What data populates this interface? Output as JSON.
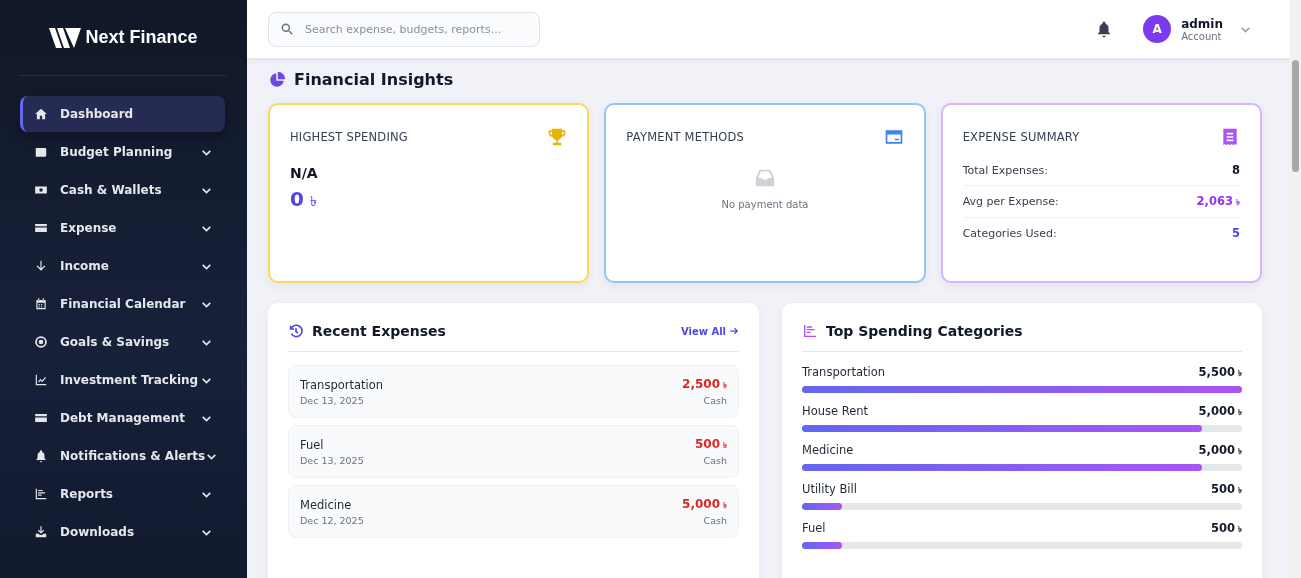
{
  "brand": "Next Finance",
  "sidebar": {
    "items": [
      {
        "label": "Dashboard",
        "selected": true,
        "has_submenu": false
      },
      {
        "label": "Budget Planning",
        "selected": false,
        "has_submenu": true
      },
      {
        "label": "Cash & Wallets",
        "selected": false,
        "has_submenu": true
      },
      {
        "label": "Expense",
        "selected": false,
        "has_submenu": true
      },
      {
        "label": "Income",
        "selected": false,
        "has_submenu": true
      },
      {
        "label": "Financial Calendar",
        "selected": false,
        "has_submenu": true
      },
      {
        "label": "Goals & Savings",
        "selected": false,
        "has_submenu": true
      },
      {
        "label": "Investment Tracking",
        "selected": false,
        "has_submenu": true
      },
      {
        "label": "Debt Management",
        "selected": false,
        "has_submenu": true
      },
      {
        "label": "Notifications & Alerts",
        "selected": false,
        "has_submenu": true
      },
      {
        "label": "Reports",
        "selected": false,
        "has_submenu": true
      },
      {
        "label": "Downloads",
        "selected": false,
        "has_submenu": true
      }
    ]
  },
  "header": {
    "search": {
      "placeholder": "Search expense, budgets, reports..."
    },
    "user": {
      "initial": "A",
      "name": "admin",
      "role": "Account"
    }
  },
  "section_title": "Financial Insights",
  "highest_spending": {
    "title": "HIGHEST SPENDING",
    "name": "N/A",
    "amount": "0",
    "currency": "৳"
  },
  "payment_methods": {
    "title": "PAYMENT METHODS",
    "empty_text": "No payment data"
  },
  "expense_summary": {
    "title": "EXPENSE SUMMARY",
    "rows": [
      {
        "label": "Total Expenses:",
        "value": "8",
        "kind": "plain"
      },
      {
        "label": "Avg per Expense:",
        "value": "2,063",
        "currency": "৳",
        "kind": "money"
      },
      {
        "label": "Categories Used:",
        "value": "5",
        "kind": "count"
      }
    ]
  },
  "recent_expenses": {
    "title": "Recent Expenses",
    "link": "View All",
    "items": [
      {
        "name": "Transportation",
        "date": "Dec 13, 2025",
        "amount": "2,500",
        "currency": "৳",
        "method": "Cash"
      },
      {
        "name": "Fuel",
        "date": "Dec 13, 2025",
        "amount": "500",
        "currency": "৳",
        "method": "Cash"
      },
      {
        "name": "Medicine",
        "date": "Dec 12, 2025",
        "amount": "5,000",
        "currency": "৳",
        "method": "Cash"
      }
    ]
  },
  "top_categories": {
    "title": "Top Spending Categories",
    "items": [
      {
        "name": "Transportation",
        "amount": "5,500",
        "currency": "৳",
        "level": 1.0
      },
      {
        "name": "House Rent",
        "amount": "5,000",
        "currency": "৳",
        "level": 0.91
      },
      {
        "name": "Medicine",
        "amount": "5,000",
        "currency": "৳",
        "level": 0.91
      },
      {
        "name": "Utility Bill",
        "amount": "500",
        "currency": "৳",
        "level": 0.09
      },
      {
        "name": "Fuel",
        "amount": "500",
        "currency": "৳",
        "level": 0.09
      }
    ]
  }
}
